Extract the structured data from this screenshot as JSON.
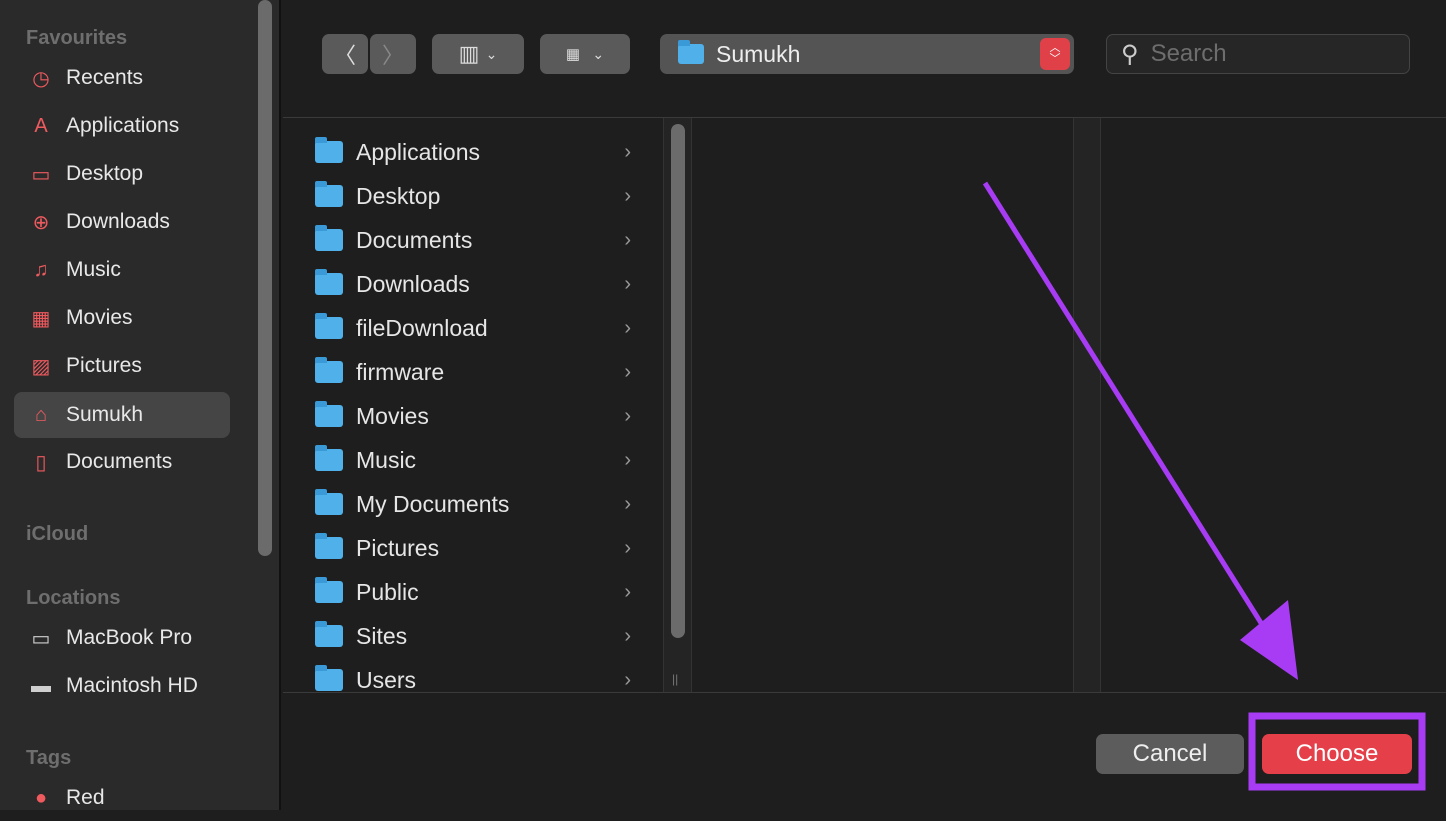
{
  "sidebar": {
    "sections": {
      "favourites": "Favourites",
      "icloud": "iCloud",
      "locations": "Locations",
      "tags": "Tags"
    },
    "favourites": [
      {
        "label": "Recents",
        "icon": "clock-icon"
      },
      {
        "label": "Applications",
        "icon": "app-store-icon"
      },
      {
        "label": "Desktop",
        "icon": "desktop-icon"
      },
      {
        "label": "Downloads",
        "icon": "download-icon"
      },
      {
        "label": "Music",
        "icon": "music-note-icon"
      },
      {
        "label": "Movies",
        "icon": "film-icon"
      },
      {
        "label": "Pictures",
        "icon": "photo-icon"
      },
      {
        "label": "Sumukh",
        "icon": "home-icon",
        "selected": true
      },
      {
        "label": "Documents",
        "icon": "document-icon"
      }
    ],
    "locations": [
      {
        "label": "MacBook Pro",
        "icon": "laptop-icon"
      },
      {
        "label": "Macintosh HD",
        "icon": "drive-icon"
      }
    ],
    "tags": [
      {
        "label": "Red",
        "color": "#ef5a5f"
      }
    ]
  },
  "toolbar": {
    "path": "Sumukh",
    "search_placeholder": "Search"
  },
  "files": [
    "Applications",
    "Desktop",
    "Documents",
    "Downloads",
    "fileDownload",
    "firmware",
    "Movies",
    "Music",
    "My Documents",
    "Pictures",
    "Public",
    "Sites",
    "Users"
  ],
  "buttons": {
    "cancel": "Cancel",
    "choose": "Choose"
  },
  "colors": {
    "accent": "#e5404a",
    "annotation": "#a83cf5"
  }
}
